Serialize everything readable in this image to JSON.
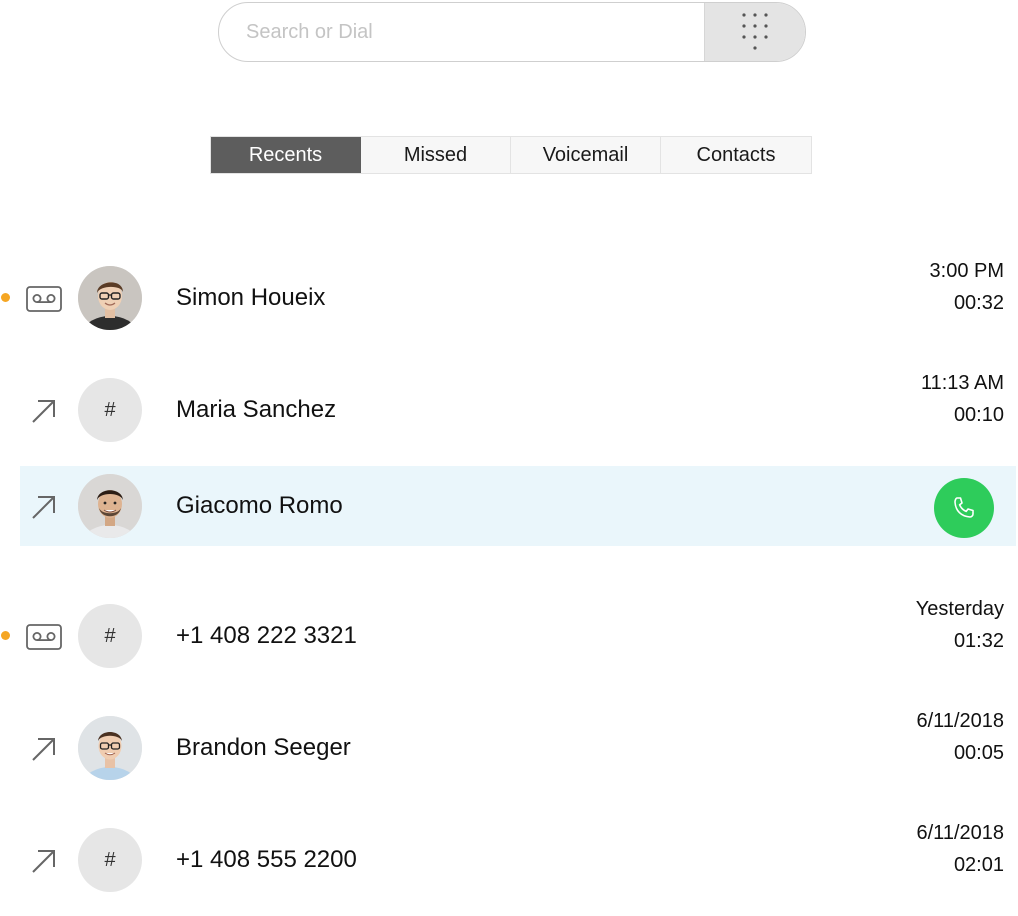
{
  "search": {
    "placeholder": "Search or Dial",
    "value": ""
  },
  "tabs": [
    {
      "label": "Recents",
      "active": true
    },
    {
      "label": "Missed",
      "active": false
    },
    {
      "label": "Voicemail",
      "active": false
    },
    {
      "label": "Contacts",
      "active": false
    }
  ],
  "calls": [
    {
      "name": "Simon Houeix",
      "type": "voicemail-icon",
      "avatar": "photo",
      "time": "3:00 PM",
      "duration": "00:32",
      "unread": true
    },
    {
      "name": "Maria Sanchez",
      "type": "outgoing-arrow-icon",
      "avatar": "hash",
      "time": "11:13 AM",
      "duration": "00:10",
      "unread": false
    },
    {
      "name": "Giacomo Romo",
      "type": "outgoing-arrow-icon",
      "avatar": "photo",
      "time": "",
      "duration": "",
      "unread": false,
      "selected": true
    },
    {
      "name": "+1 408 222 3321",
      "type": "voicemail-icon",
      "avatar": "hash",
      "time": "Yesterday",
      "duration": "01:32",
      "unread": true
    },
    {
      "name": "Brandon Seeger",
      "type": "outgoing-arrow-icon",
      "avatar": "photo",
      "time": "6/11/2018",
      "duration": "00:05",
      "unread": false
    },
    {
      "name": "+1 408 555 2200",
      "type": "outgoing-arrow-icon",
      "avatar": "hash",
      "time": "6/11/2018",
      "duration": "02:01",
      "unread": false
    }
  ],
  "avatar_hash_symbol": "#",
  "colors": {
    "unread_dot": "#f5a623",
    "active_tab": "#5d5d5d",
    "selected_row": "#eaf6fb",
    "call_button": "#2ecc5b",
    "icon_gray": "#666666"
  }
}
